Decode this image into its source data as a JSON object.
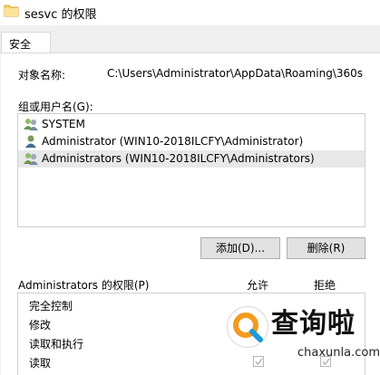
{
  "window": {
    "title": "sesvc 的权限"
  },
  "tabs": [
    {
      "label": "安全"
    }
  ],
  "object": {
    "label": "对象名称:",
    "value": "C:\\Users\\Administrator\\AppData\\Roaming\\360s"
  },
  "groups": {
    "label": "组或用户名(G):",
    "items": [
      {
        "name": "SYSTEM",
        "icon": "user-group-icon",
        "selected": false
      },
      {
        "name": "Administrator (WIN10-2018ILCFY\\Administrator)",
        "icon": "user-icon",
        "selected": false
      },
      {
        "name": "Administrators (WIN10-2018ILCFY\\Administrators)",
        "icon": "user-group-icon",
        "selected": true
      }
    ]
  },
  "buttons": {
    "add": "添加(D)...",
    "remove": "删除(R)"
  },
  "permissions": {
    "label": "Administrators 的权限(P)",
    "allow_header": "允许",
    "deny_header": "拒绝",
    "rows": [
      {
        "name": "完全控制"
      },
      {
        "name": "修改"
      },
      {
        "name": "读取和执行"
      },
      {
        "name": "读取",
        "allow_checked": true,
        "deny_checked": true
      }
    ]
  },
  "watermark": {
    "text_cn": "查询啦",
    "text_en": "chaxunla.com"
  },
  "colors": {
    "selection": "#e8e8e8",
    "window_bg": "#f0f0f0",
    "button_bg": "#e1e1e1"
  }
}
